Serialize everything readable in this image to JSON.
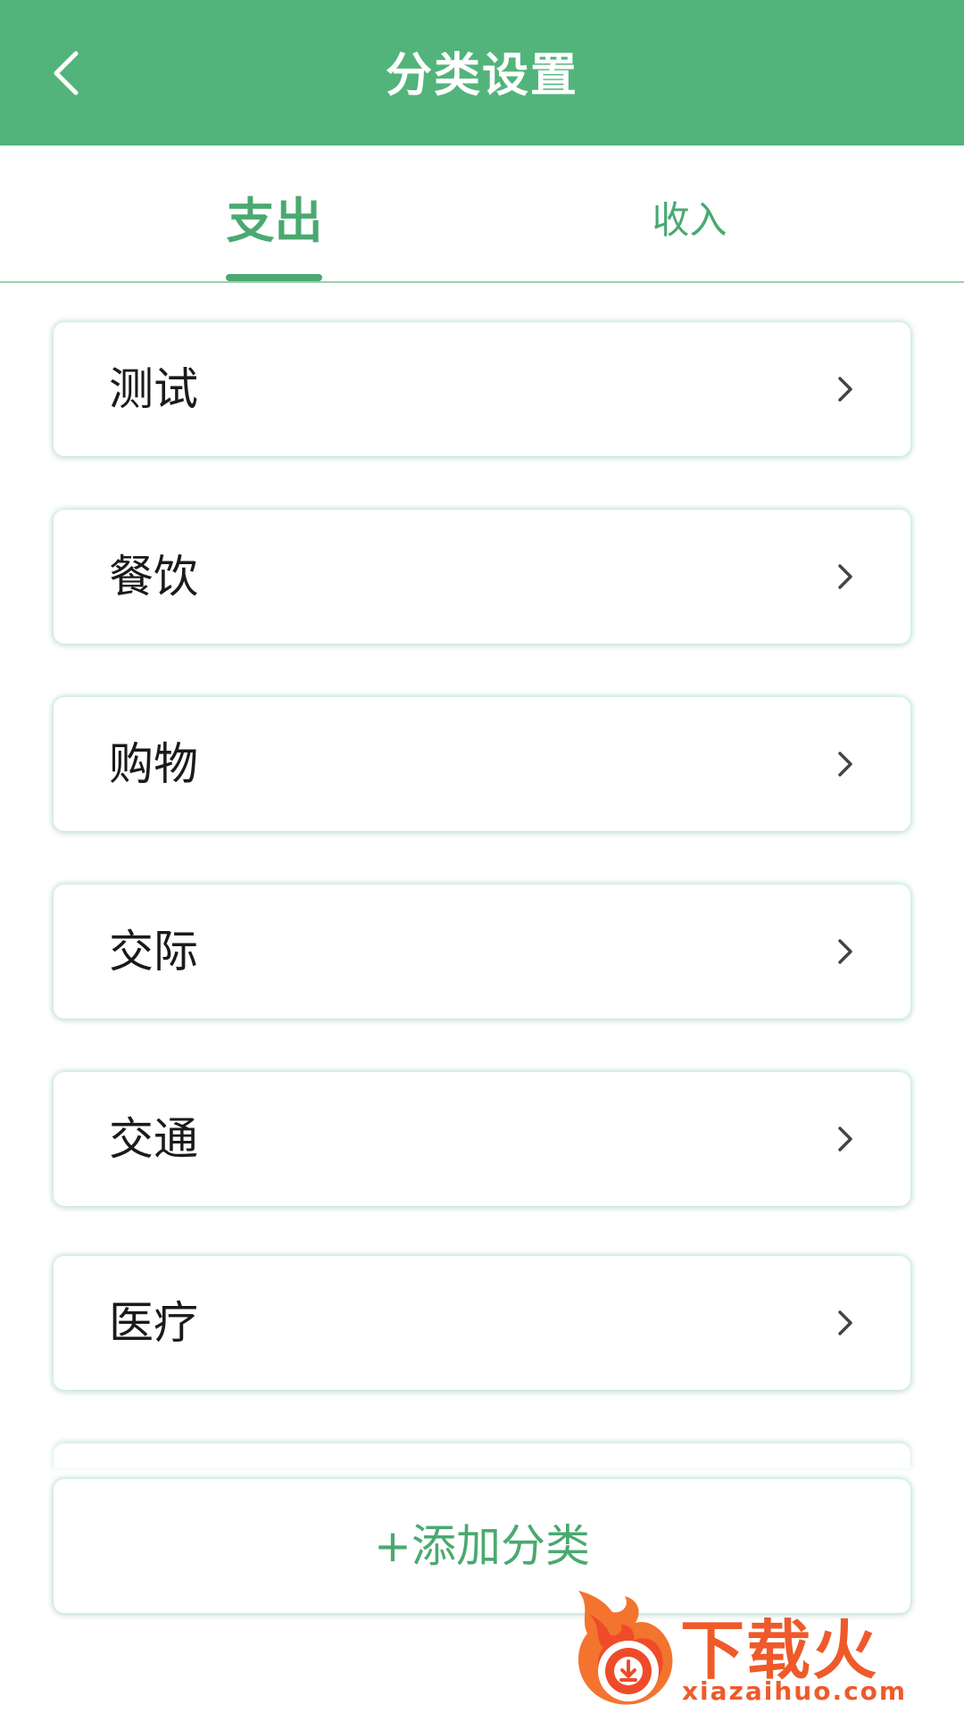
{
  "header": {
    "title": "分类设置",
    "back_icon": "chevron-left-icon"
  },
  "tabs": [
    {
      "label": "支出",
      "active": true
    },
    {
      "label": "收入",
      "active": false
    }
  ],
  "categories": [
    {
      "label": "测试"
    },
    {
      "label": "餐饮"
    },
    {
      "label": "购物"
    },
    {
      "label": "交际"
    },
    {
      "label": "交通"
    },
    {
      "label": "医疗"
    }
  ],
  "add_button": {
    "label": "+添加分类"
  },
  "watermark": {
    "name": "下载火",
    "url": "xiazaihuo.com"
  },
  "colors": {
    "primary": "#52b47a",
    "accent_text": "#4aa970",
    "watermark": "#ef5a2a"
  }
}
